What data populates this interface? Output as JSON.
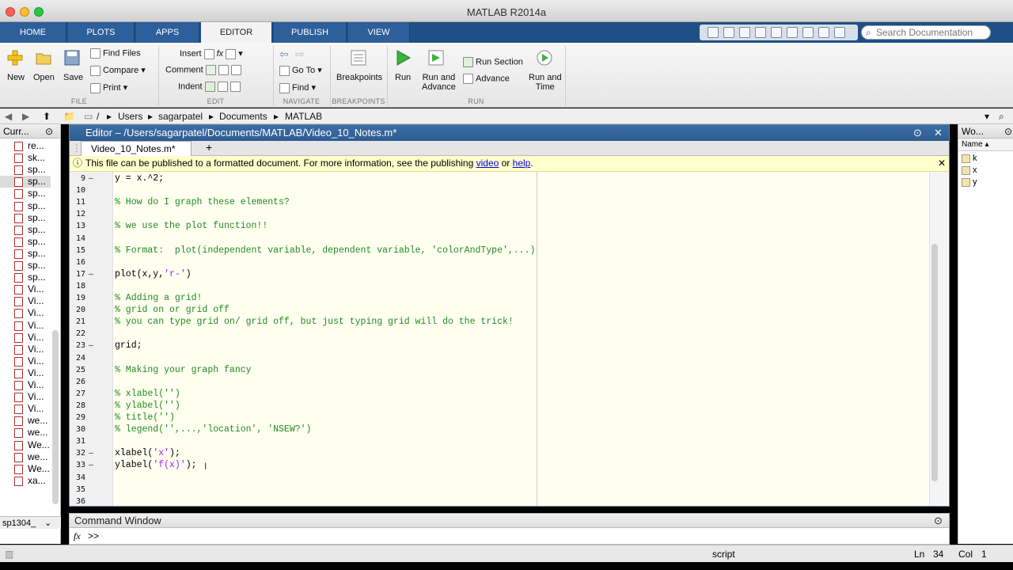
{
  "window": {
    "title": "MATLAB R2014a"
  },
  "tabs": [
    "HOME",
    "PLOTS",
    "APPS",
    "EDITOR",
    "PUBLISH",
    "VIEW"
  ],
  "active_tab": "EDITOR",
  "search": {
    "placeholder": "Search Documentation"
  },
  "ribbon": {
    "file": {
      "new": "New",
      "open": "Open",
      "save": "Save",
      "find_files": "Find Files",
      "compare": "Compare",
      "print": "Print",
      "group": "FILE"
    },
    "edit": {
      "insert": "Insert",
      "comment": "Comment",
      "indent": "Indent",
      "fx": "fx",
      "group": "EDIT"
    },
    "navigate": {
      "goto": "Go To",
      "find": "Find",
      "group": "NAVIGATE"
    },
    "breakpoints": {
      "label": "Breakpoints",
      "group": "BREAKPOINTS"
    },
    "run": {
      "run": "Run",
      "run_advance": "Run and\nAdvance",
      "run_section": "Run Section",
      "advance": "Advance",
      "run_time": "Run and\nTime",
      "group": "RUN"
    }
  },
  "address": {
    "root": "/",
    "parts": [
      "Users",
      "sagarpatel",
      "Documents",
      "MATLAB"
    ]
  },
  "current_folder": {
    "header": "Curr...",
    "items": [
      "re...",
      "sk...",
      "sp...",
      "sp...",
      "sp...",
      "sp...",
      "sp...",
      "sp...",
      "sp...",
      "sp...",
      "sp...",
      "sp...",
      "Vi...",
      "Vi...",
      "Vi...",
      "Vi...",
      "Vi...",
      "Vi...",
      "Vi...",
      "Vi...",
      "Vi...",
      "Vi...",
      "Vi...",
      "we...",
      "we...",
      "We...",
      "we...",
      "We...",
      "xa..."
    ],
    "footer": "sp1304_"
  },
  "editor": {
    "title": "Editor – /Users/sagarpatel/Documents/MATLAB/Video_10_Notes.m*",
    "tab": "Video_10_Notes.m*",
    "notice_pre": "This file can be published to a formatted document. For more information, see the publishing ",
    "notice_video": "video",
    "notice_or": " or ",
    "notice_help": "help",
    "notice_end": ".",
    "lines": [
      {
        "n": "9",
        "dash": "–",
        "text": "y = x.^2;",
        "kind": "code"
      },
      {
        "n": "10",
        "dash": "",
        "text": "",
        "kind": "code"
      },
      {
        "n": "11",
        "dash": "",
        "text": "% How do I graph these elements?",
        "kind": "comment"
      },
      {
        "n": "12",
        "dash": "",
        "text": "",
        "kind": "code"
      },
      {
        "n": "13",
        "dash": "",
        "text": "% we use the plot function!!",
        "kind": "comment"
      },
      {
        "n": "14",
        "dash": "",
        "text": "",
        "kind": "code"
      },
      {
        "n": "15",
        "dash": "",
        "text": "% Format:  plot(independent variable, dependent variable, 'colorAndType',...)",
        "kind": "comment"
      },
      {
        "n": "16",
        "dash": "",
        "text": "",
        "kind": "code"
      },
      {
        "n": "17",
        "dash": "–",
        "text": "plot(x,y,'r-')",
        "kind": "plot"
      },
      {
        "n": "18",
        "dash": "",
        "text": "",
        "kind": "code"
      },
      {
        "n": "19",
        "dash": "",
        "text": "% Adding a grid!",
        "kind": "comment"
      },
      {
        "n": "20",
        "dash": "",
        "text": "% grid on or grid off",
        "kind": "comment"
      },
      {
        "n": "21",
        "dash": "",
        "text": "% you can type grid on/ grid off, but just typing grid will do the trick!",
        "kind": "comment"
      },
      {
        "n": "22",
        "dash": "",
        "text": "",
        "kind": "code"
      },
      {
        "n": "23",
        "dash": "–",
        "text": "grid;",
        "kind": "code"
      },
      {
        "n": "24",
        "dash": "",
        "text": "",
        "kind": "code"
      },
      {
        "n": "25",
        "dash": "",
        "text": "% Making your graph fancy",
        "kind": "comment"
      },
      {
        "n": "26",
        "dash": "",
        "text": "",
        "kind": "code"
      },
      {
        "n": "27",
        "dash": "",
        "text": "% xlabel('')",
        "kind": "comment"
      },
      {
        "n": "28",
        "dash": "",
        "text": "% ylabel('')",
        "kind": "comment"
      },
      {
        "n": "29",
        "dash": "",
        "text": "% title('')",
        "kind": "comment"
      },
      {
        "n": "30",
        "dash": "",
        "text": "% legend('',...,'location', 'NSEW?')",
        "kind": "comment"
      },
      {
        "n": "31",
        "dash": "",
        "text": "",
        "kind": "code"
      },
      {
        "n": "32",
        "dash": "–",
        "text": "xlabel('x');",
        "kind": "xl"
      },
      {
        "n": "33",
        "dash": "–",
        "text": "ylabel('f(x)');",
        "kind": "yl"
      },
      {
        "n": "34",
        "dash": "",
        "text": "",
        "kind": "code"
      },
      {
        "n": "35",
        "dash": "",
        "text": "",
        "kind": "code"
      },
      {
        "n": "36",
        "dash": "",
        "text": "",
        "kind": "code"
      }
    ]
  },
  "command_window": {
    "title": "Command Window",
    "fx": "fx",
    "prompt": ">>"
  },
  "workspace": {
    "header": "Wo...",
    "col": "Name ▴",
    "vars": [
      "k",
      "x",
      "y"
    ]
  },
  "status": {
    "mode": "script",
    "ln_label": "Ln",
    "ln": "34",
    "col_label": "Col",
    "col": "1"
  },
  "colors": {
    "tabbar": "#1f4f86",
    "editor_header": "#2d5c92",
    "comment": "#228b22",
    "string": "#a020f0",
    "notice_bg": "#ffffcc"
  }
}
